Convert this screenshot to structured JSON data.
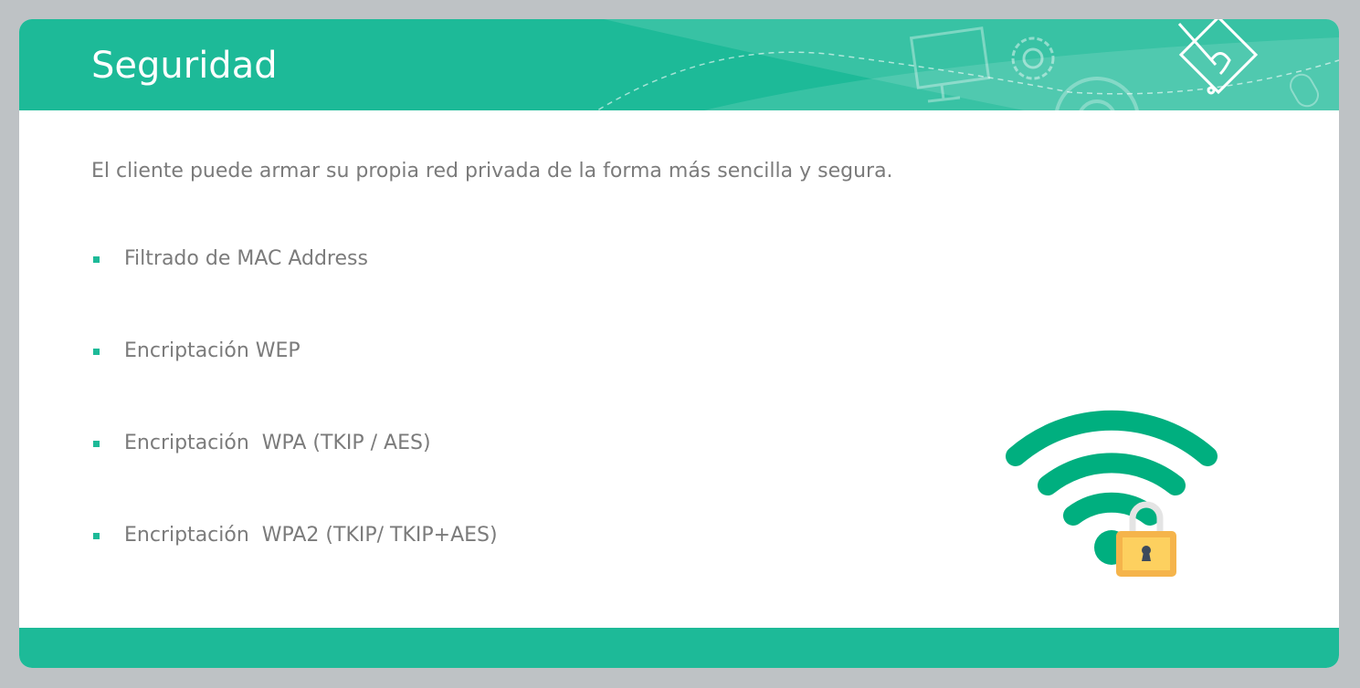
{
  "slide": {
    "title": "Seguridad",
    "intro": "El cliente puede armar su propia red privada de la forma más sencilla y segura.",
    "bullets": [
      "Filtrado de MAC Address",
      "Encriptación WEP",
      "Encriptación  WPA (TKIP / AES)",
      "Encriptación  WPA2 (TKIP/ TKIP+AES)"
    ],
    "illustration": "wifi-lock-icon"
  },
  "colors": {
    "accent": "#1dba98",
    "wifi": "#00af7f",
    "lock": "#fdd05f",
    "lock_border": "#f5b44b"
  }
}
